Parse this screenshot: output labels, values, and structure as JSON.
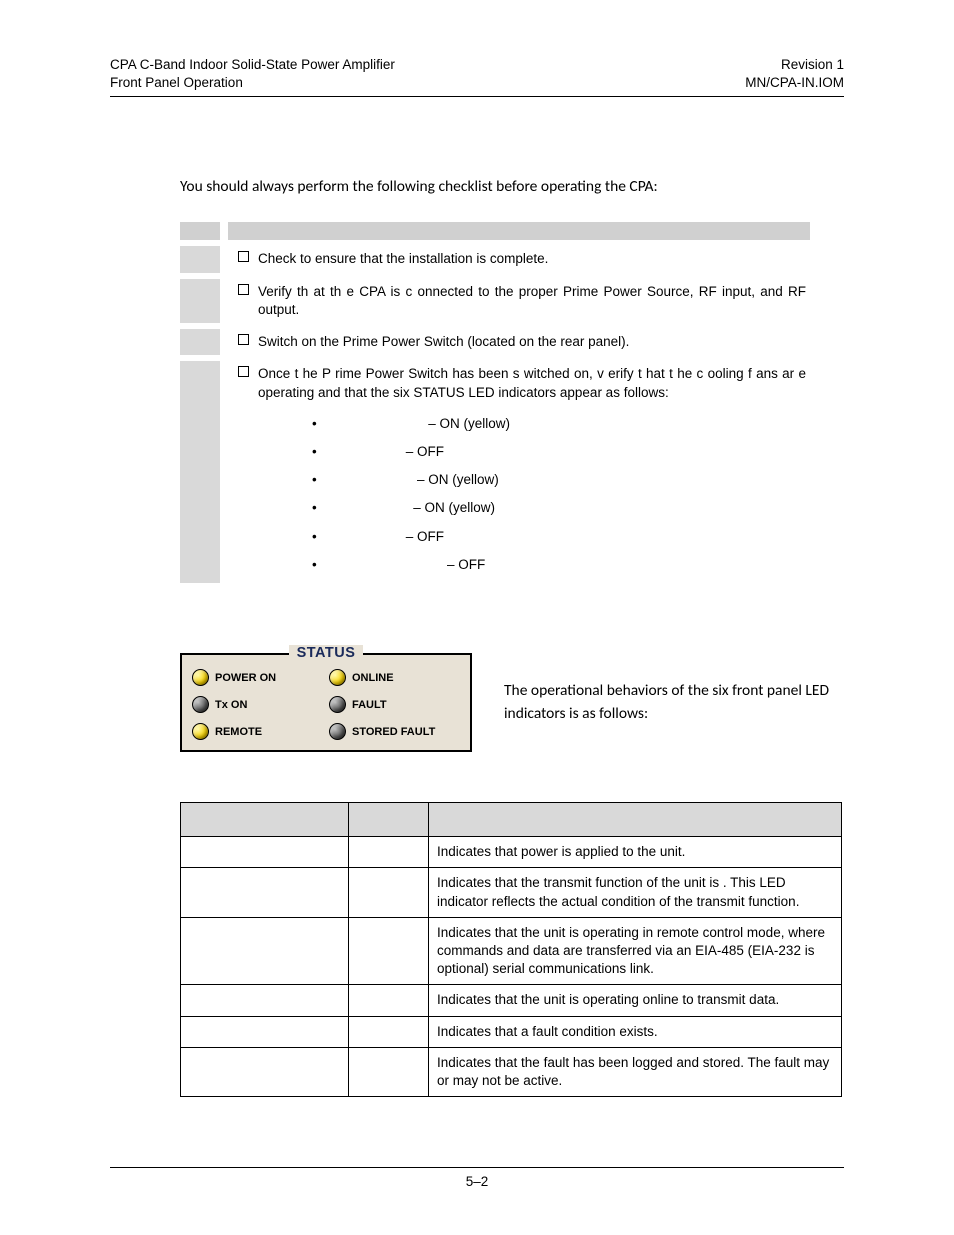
{
  "header": {
    "leftLine1": "CPA C-Band Indoor Solid-State Power Amplifier",
    "leftLine2": "Front Panel Operation",
    "rightLine1": "Revision 1",
    "rightLine2": "MN/CPA-IN.IOM"
  },
  "intro": "You should always perform the following checklist before operating the CPA:",
  "checklist": [
    {
      "text": "Check to ensure that the installation is complete.",
      "hasBullets": false
    },
    {
      "text": "Verify th at th e  CPA  is c onnected  to  the  proper  Prime  Power  Source,  RF  input,  and  RF output.",
      "hasBullets": false
    },
    {
      "text": "Switch on the Prime Power Switch (located on the rear panel).",
      "hasBullets": false
    },
    {
      "text": "Once t he P rime  Power  Switch  has been  s witched on,  v erify t hat t he c ooling f ans ar e operating and that the six STATUS LED indicators appear as follows:",
      "hasBullets": true
    }
  ],
  "bullets": [
    "               – ON (yellow)",
    "         – OFF",
    "            – ON (yellow)",
    "           – ON (yellow)",
    "         – OFF",
    "                    – OFF"
  ],
  "statusPanel": {
    "title": "STATUS",
    "leds": [
      {
        "label": "POWER ON",
        "state": "yellow"
      },
      {
        "label": "ONLINE",
        "state": "yellow"
      },
      {
        "label": "Tx ON",
        "state": "off"
      },
      {
        "label": "FAULT",
        "state": "off"
      },
      {
        "label": "REMOTE",
        "state": "yellow"
      },
      {
        "label": "STORED FAULT",
        "state": "off"
      }
    ]
  },
  "statusCaption": "The operational behaviors of the six front panel LED indicators is as follows:",
  "ledTable": {
    "headers": [
      "",
      "",
      ""
    ],
    "rows": [
      {
        "c1": "",
        "c2": "",
        "c3": "Indicates that power is applied to the unit."
      },
      {
        "c1": "",
        "c2": "",
        "c3": "Indicates that the transmit function of the unit is      . This LED indicator reflects the actual condition of the transmit function."
      },
      {
        "c1": "",
        "c2": "",
        "c3": "Indicates that the unit is operating in remote control mode, where commands and data are transferred via an EIA-485 (EIA-232 is optional) serial communications link."
      },
      {
        "c1": "",
        "c2": "",
        "c3": "Indicates that the unit is operating online to transmit data."
      },
      {
        "c1": "",
        "c2": "",
        "c3": "Indicates that a fault condition exists."
      },
      {
        "c1": "",
        "c2": "",
        "c3": "Indicates that the fault has been logged and stored. The fault may or may not be active."
      }
    ]
  },
  "footer": {
    "pageNum": "5–2"
  }
}
